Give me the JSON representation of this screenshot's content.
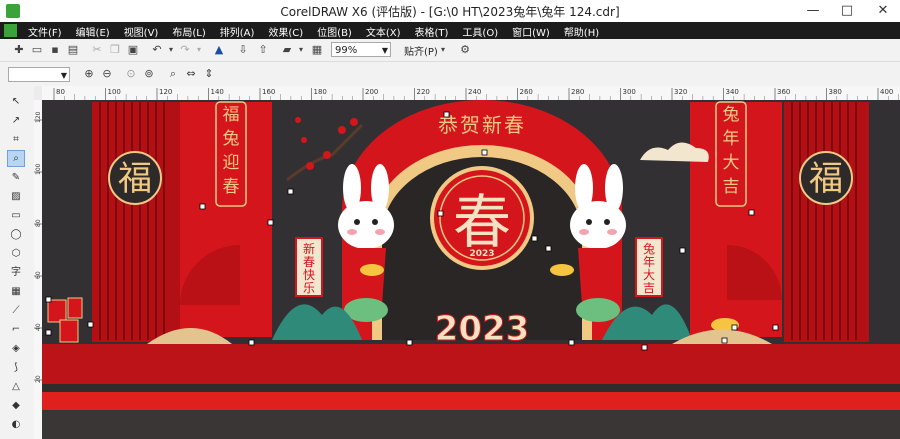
{
  "window": {
    "title": "CorelDRAW X6 (评估版) - [G:\\0 HT\\2023兔年\\兔年 124.cdr]",
    "controls": [
      "—",
      "□",
      "✕"
    ]
  },
  "menu": {
    "items": [
      "文件(F)",
      "编辑(E)",
      "视图(V)",
      "布局(L)",
      "排列(A)",
      "效果(C)",
      "位图(B)",
      "文本(X)",
      "表格(T)",
      "工具(O)",
      "窗口(W)",
      "帮助(H)"
    ]
  },
  "toolbar": {
    "zoom_value": "99%",
    "snap_label": "贴齐(P)",
    "object_dropdown_value": ""
  },
  "rulers": {
    "h_ticks": [
      "80",
      "100",
      "120",
      "140",
      "160",
      "180",
      "200",
      "220",
      "240",
      "260",
      "280",
      "300",
      "320",
      "340",
      "360",
      "380",
      "400"
    ],
    "v_ticks": [
      "120",
      "100",
      "80",
      "60",
      "40",
      "20"
    ]
  },
  "artwork": {
    "arch_title": "恭贺新春",
    "left_banner": "福兔迎春",
    "right_banner": "兔年大吉",
    "center_char": "春",
    "year": "2023",
    "small_year": "2023",
    "fu_char": "福",
    "left_scroll": "新春快乐",
    "right_scroll": "兔年大吉",
    "colors": {
      "red": "#d5151c",
      "dark_red": "#9e0d12",
      "gold": "#f0c985",
      "canvas_bg": "#333033"
    }
  }
}
